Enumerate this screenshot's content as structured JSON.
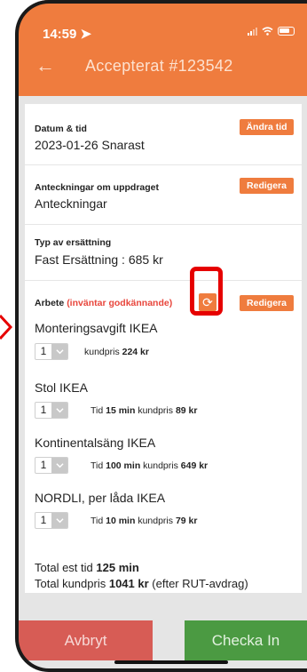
{
  "status_bar": {
    "time": "14:59"
  },
  "header": {
    "title": "Accepterat #123542"
  },
  "sections": {
    "datetime": {
      "label": "Datum & tid",
      "value": "2023-01-26 Snarast",
      "action": "Ändra tid"
    },
    "notes": {
      "label": "Anteckningar om uppdraget",
      "value": "Anteckningar",
      "action": "Redigera"
    },
    "compensation": {
      "label": "Typ av ersättning",
      "value": "Fast Ersättning : 685 kr"
    },
    "work": {
      "label": "Arbete",
      "status": "(inväntar godkännande)",
      "action": "Redigera"
    }
  },
  "items": [
    {
      "name": "Monteringsavgift IKEA",
      "qty": "1",
      "price_label": "kundpris",
      "price": "224 kr"
    },
    {
      "name": "Stol IKEA",
      "qty": "1",
      "time_label": "Tid",
      "time": "15 min",
      "price_label": "kundpris",
      "price": "89 kr"
    },
    {
      "name": "Kontinentalsäng IKEA",
      "qty": "1",
      "time_label": "Tid",
      "time": "100 min",
      "price_label": "kundpris",
      "price": "649 kr"
    },
    {
      "name": "NORDLI, per låda IKEA",
      "qty": "1",
      "time_label": "Tid",
      "time": "10 min",
      "price_label": "kundpris",
      "price": "79 kr"
    }
  ],
  "totals": {
    "time_label": "Total est tid",
    "time": "125 min",
    "price_label": "Total kundpris",
    "price": "1041 kr",
    "price_note": "(efter RUT-avdrag)"
  },
  "buttons": {
    "cancel": "Avbryt",
    "checkin": "Checka In"
  },
  "colors": {
    "accent": "#ef7c3e",
    "cancel": "#d75c55",
    "checkin": "#4b9a42",
    "pending": "#e8463c",
    "highlight": "#e60000"
  },
  "icons": {
    "back": "arrow-left-icon",
    "refresh": "refresh-icon",
    "dropdown": "chevron-down-icon"
  }
}
